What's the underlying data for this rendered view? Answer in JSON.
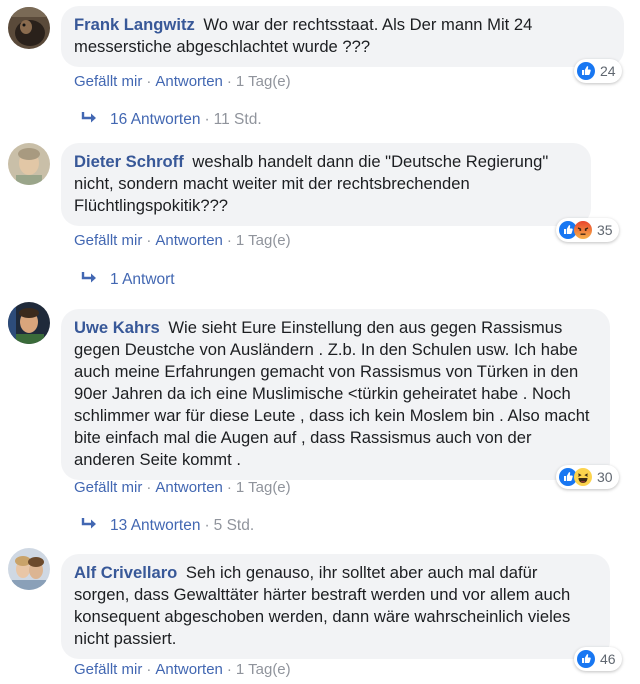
{
  "comments": [
    {
      "author": "Frank Langwitz",
      "text": "Wo war der rechtsstaat. Als Der mann Mit 24 messerstiche abgeschlachtet wurde ???",
      "like_label": "Gefällt mir",
      "reply_label": "Antworten",
      "time": "1 Tag(e)",
      "reaction_count": "24",
      "replies_count": "16 Antworten",
      "replies_time": "11 Std."
    },
    {
      "author": "Dieter Schroff",
      "text": "weshalb handelt dann die \"Deutsche Regierung\" nicht, sondern macht weiter mit der rechtsbrechenden Flüchtlingspokitik???",
      "like_label": "Gefällt mir",
      "reply_label": "Antworten",
      "time": "1 Tag(e)",
      "reaction_count": "35",
      "replies_count": "1 Antwort"
    },
    {
      "author": "Uwe Kahrs",
      "text": "Wie sieht Eure Einstellung den aus gegen Rassismus gegen Deustche von Ausländern . Z.b. In den Schulen usw. Ich habe auch meine Erfahrungen gemacht von Rassismus von Türken in den 90er Jahren da ich eine Muslimische <türkin geheiratet habe . Noch schlimmer war für diese Leute , dass ich kein Moslem bin . Also macht bite einfach mal die Augen auf , dass Rassismus auch von der anderen Seite kommt .",
      "like_label": "Gefällt mir",
      "reply_label": "Antworten",
      "time": "1 Tag(e)",
      "reaction_count": "30",
      "replies_count": "13 Antworten",
      "replies_time": "5 Std."
    },
    {
      "author": "Alf Crivellaro",
      "text": "Seh ich genauso, ihr solltet aber auch mal dafür sorgen, dass Gewalttäter härter bestraft werden und vor allem auch konsequent abgeschoben werden, dann wäre wahrscheinlich vieles nicht passiert.",
      "like_label": "Gefällt mir",
      "reply_label": "Antworten",
      "time": "1 Tag(e)",
      "reaction_count": "46"
    }
  ],
  "icons": {
    "reply_arrow": "reply-arrow-icon",
    "like": "like-reaction-icon",
    "angry": "angry-reaction-icon",
    "haha": "haha-reaction-icon"
  },
  "colors": {
    "author": "#385898",
    "link": "#4267b2",
    "muted": "#90949c",
    "bubble": "#f2f3f5",
    "like": "#1877f2",
    "angry": "#f0793c",
    "haha": "#fcd34d"
  }
}
